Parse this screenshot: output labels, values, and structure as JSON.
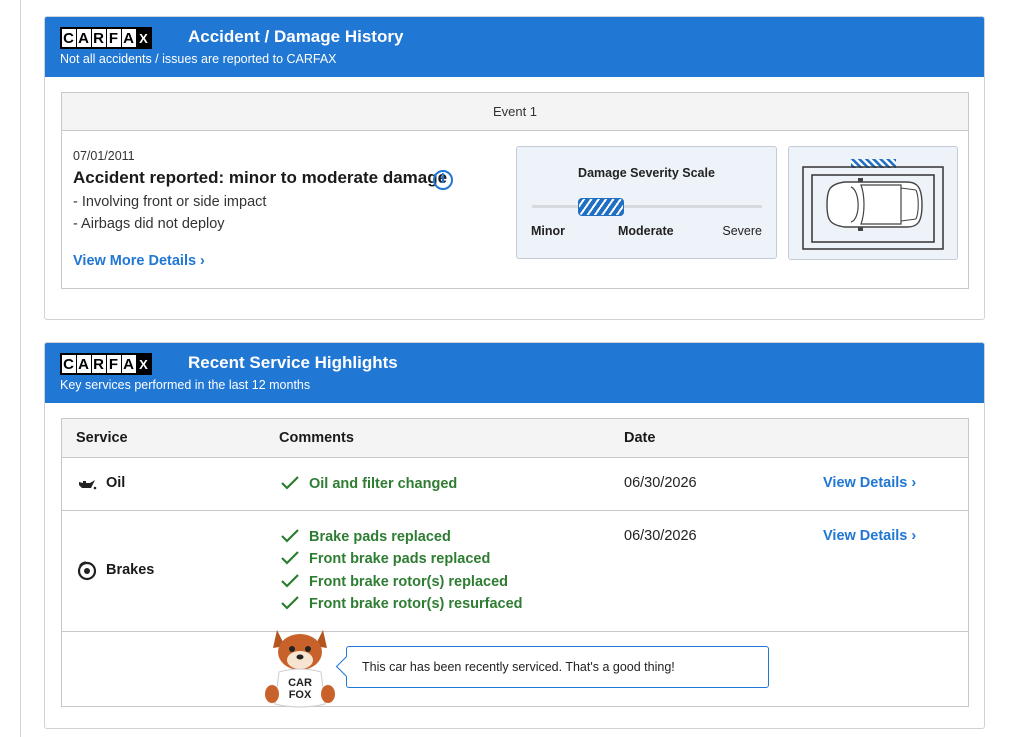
{
  "logo_letters": [
    "C",
    "A",
    "R",
    "F",
    "A",
    "X"
  ],
  "accident": {
    "title": "Accident / Damage History",
    "subtitle": "Not all accidents / issues are reported to CARFAX",
    "event_label": "Event 1",
    "date": "07/01/2011",
    "headline": "Accident reported: minor to moderate damage",
    "info_glyph": "i",
    "details": [
      "- Involving front or side impact",
      "- Airbags did not deploy"
    ],
    "link_label": "View More Details ›",
    "severity": {
      "title": "Damage Severity Scale",
      "labels": [
        "Minor",
        "Moderate",
        "Severe"
      ],
      "level_from": 0.2,
      "level_to": 0.4
    },
    "damage_area": "front",
    "icons": [
      "info-icon",
      "car-diagram-icon"
    ]
  },
  "service": {
    "title": "Recent Service Highlights",
    "subtitle": "Key services performed in the last 12 months",
    "columns": [
      "Service",
      "Comments",
      "Date"
    ],
    "rows": [
      {
        "name": "Oil",
        "icon": "oil-can-icon",
        "comments": [
          "Oil and filter changed"
        ],
        "date": "06/30/2026",
        "link": "View Details ›"
      },
      {
        "name": "Brakes",
        "icon": "brake-disc-icon",
        "comments": [
          "Brake pads replaced",
          "Front brake pads replaced",
          "Front brake rotor(s) replaced",
          "Front brake rotor(s) resurfaced"
        ],
        "date": "06/30/2026",
        "link": "View Details ›"
      }
    ],
    "fox_shirt": [
      "CAR",
      "FOX"
    ],
    "message": "This car has been recently serviced. That's a good thing!"
  },
  "colors": {
    "header_blue": "#2077d4",
    "comment_green": "#2e7d32",
    "panel_bg": "#eef3f9"
  }
}
